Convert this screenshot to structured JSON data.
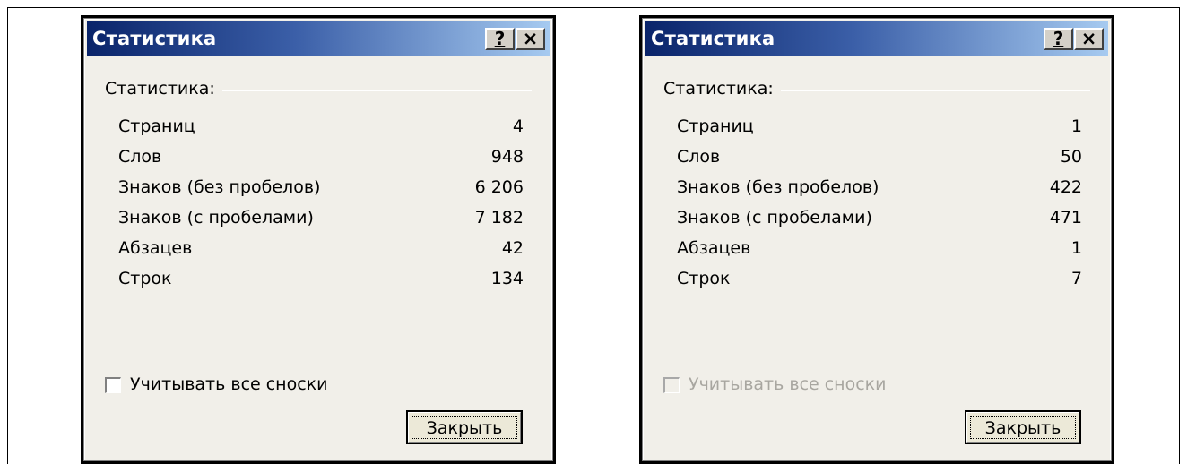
{
  "dialogs": [
    {
      "title": "Статистика",
      "help_button": "?",
      "close_button": "×",
      "group_label": "Статистика:",
      "stats": [
        {
          "label": "Страниц",
          "value": "4"
        },
        {
          "label": "Слов",
          "value": "948"
        },
        {
          "label": "Знаков (без пробелов)",
          "value": "6 206"
        },
        {
          "label": "Знаков (с пробелами)",
          "value": "7 182"
        },
        {
          "label": "Абзацев",
          "value": "42"
        },
        {
          "label": "Строк",
          "value": "134"
        }
      ],
      "checkbox_label_accel": "У",
      "checkbox_label_rest": "читывать все сноски",
      "checkbox_checked": false,
      "checkbox_enabled": true,
      "close_label": "Закрыть"
    },
    {
      "title": "Статистика",
      "help_button": "?",
      "close_button": "×",
      "group_label": "Статистика:",
      "stats": [
        {
          "label": "Страниц",
          "value": "1"
        },
        {
          "label": "Слов",
          "value": "50"
        },
        {
          "label": "Знаков (без пробелов)",
          "value": "422"
        },
        {
          "label": "Знаков (с пробелами)",
          "value": "471"
        },
        {
          "label": "Абзацев",
          "value": "1"
        },
        {
          "label": "Строк",
          "value": "7"
        }
      ],
      "checkbox_label_accel": "У",
      "checkbox_label_rest": "читывать все сноски",
      "checkbox_checked": false,
      "checkbox_enabled": false,
      "close_label": "Закрыть"
    }
  ]
}
